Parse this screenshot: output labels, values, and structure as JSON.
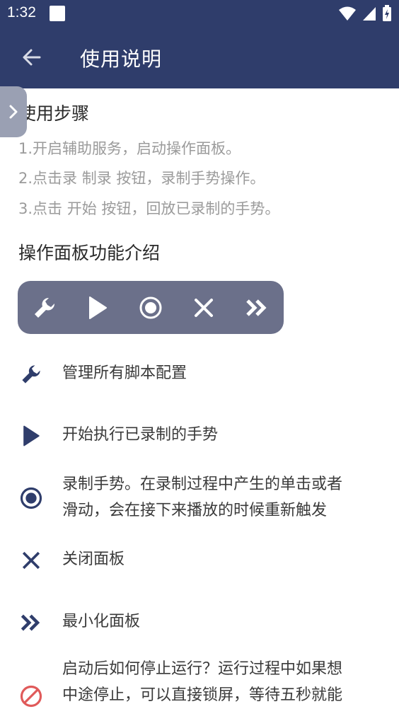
{
  "status_bar": {
    "time": "1:32"
  },
  "app_bar": {
    "title": "使用说明"
  },
  "section_steps": {
    "heading": "使用步骤",
    "steps": [
      "1.开启辅助服务，启动操作面板。",
      "2.点击录 制录 按钮，录制手势操作。",
      "3.点击 开始 按钮，回放已录制的手势。"
    ]
  },
  "section_panel": {
    "heading": "操作面板功能介绍",
    "panel_buttons": [
      "wrench-icon",
      "play-icon",
      "record-icon",
      "close-icon",
      "double-chevron-icon"
    ]
  },
  "features": [
    {
      "icon": "wrench-icon",
      "text": "管理所有脚本配置"
    },
    {
      "icon": "play-icon",
      "text": "开始执行已录制的手势"
    },
    {
      "icon": "record-icon",
      "line1": "录制手势。在录制过程中产生的单击或者",
      "line2": "滑动，会在接下来播放的时候重新触发"
    },
    {
      "icon": "close-icon",
      "text": "关闭面板"
    },
    {
      "icon": "double-chevron-icon",
      "text": "最小化面板"
    },
    {
      "icon": "stop-icon",
      "line1": "启动后如何停止运行？运行过程中如果想",
      "line2": "中途停止，可以直接锁屏，等待五秒就能"
    }
  ],
  "colors": {
    "primary": "#2f3d6b",
    "panel": "#6b708a",
    "side_tab": "#9aa0b3",
    "stop": "#e05a5a",
    "step_text": "#9b9b9b"
  }
}
